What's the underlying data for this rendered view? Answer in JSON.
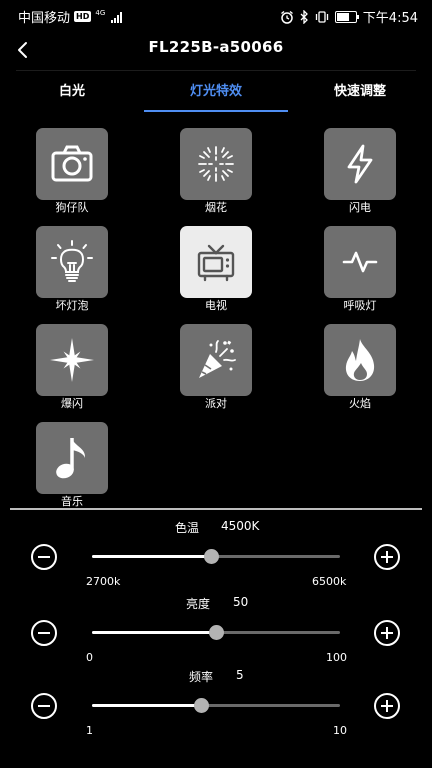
{
  "status_bar": {
    "carrier": "中国移动",
    "hd": "HD",
    "network": "4G",
    "time": "下午4:54"
  },
  "header": {
    "title": "FL225B-a50066"
  },
  "tabs": [
    {
      "label": "白光",
      "active": false
    },
    {
      "label": "灯光特效",
      "active": true
    },
    {
      "label": "快速调整",
      "active": false
    }
  ],
  "effects": [
    {
      "label": "狗仔队",
      "icon": "camera-icon",
      "selected": false
    },
    {
      "label": "烟花",
      "icon": "fireworks-icon",
      "selected": false
    },
    {
      "label": "闪电",
      "icon": "lightning-icon",
      "selected": false
    },
    {
      "label": "坏灯泡",
      "icon": "lightbulb-icon",
      "selected": false
    },
    {
      "label": "电视",
      "icon": "tv-icon",
      "selected": true
    },
    {
      "label": "呼吸灯",
      "icon": "pulse-icon",
      "selected": false
    },
    {
      "label": "爆闪",
      "icon": "sparkle-icon",
      "selected": false
    },
    {
      "label": "派对",
      "icon": "party-popper-icon",
      "selected": false
    },
    {
      "label": "火焰",
      "icon": "flame-icon",
      "selected": false
    },
    {
      "label": "音乐",
      "icon": "music-note-icon",
      "selected": false
    }
  ],
  "sliders": {
    "color_temp": {
      "label": "色温",
      "value": "4500K",
      "min_label": "2700k",
      "max_label": "6500k",
      "level": 0.48
    },
    "brightness": {
      "label": "亮度",
      "value": "50",
      "min_label": "0",
      "max_label": "100",
      "level": 0.5
    },
    "frequency": {
      "label": "频率",
      "value": "5",
      "min_label": "1",
      "max_label": "10",
      "level": 0.44
    }
  },
  "colors": {
    "accent": "#4f8ef2",
    "tile": "#6f6f6f",
    "tile_selected": "#ececec",
    "background": "#000000"
  }
}
